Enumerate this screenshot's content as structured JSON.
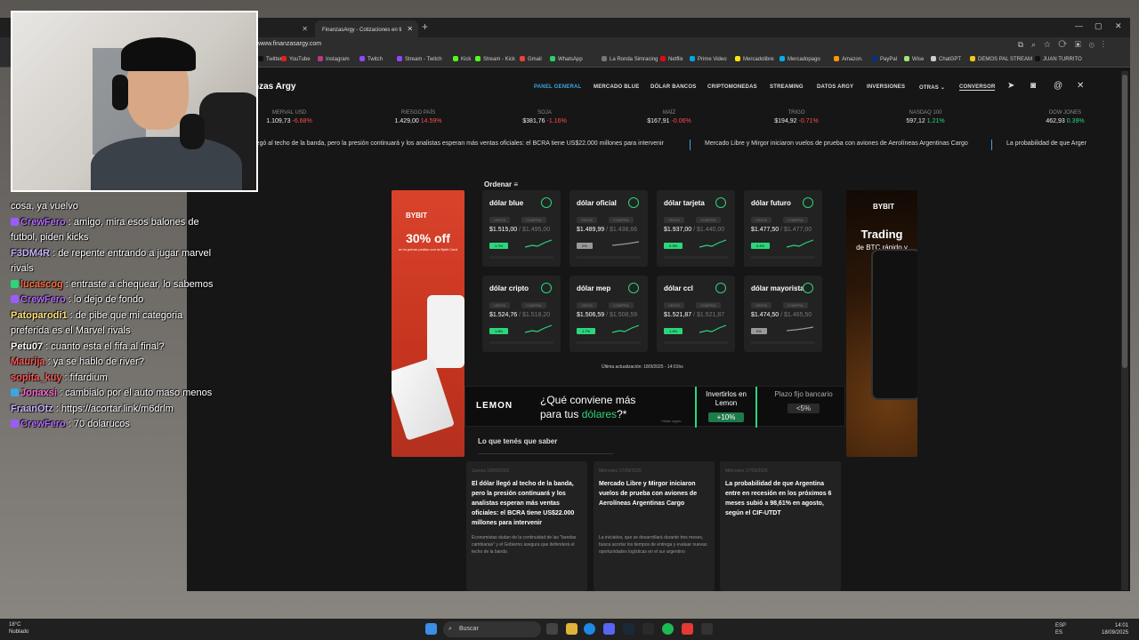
{
  "browser": {
    "tabs": [
      {
        "label": "FinanzasArgy - Cotizaciones en ti"
      }
    ],
    "url": "www.finanzasargy.com",
    "bookmarks": [
      {
        "label": "Twitter",
        "color": "#111"
      },
      {
        "label": "YouTube",
        "color": "#e62117"
      },
      {
        "label": "Instagram",
        "color": "#c13584"
      },
      {
        "label": "Twitch",
        "color": "#9146ff"
      },
      {
        "label": "Stream - Twitch",
        "color": "#9146ff"
      },
      {
        "label": "Kick",
        "color": "#53fc18"
      },
      {
        "label": "Stream - Kick",
        "color": "#53fc18"
      },
      {
        "label": "Gmail",
        "color": "#ea4335"
      },
      {
        "label": "WhatsApp",
        "color": "#25d366"
      },
      {
        "label": "La Ronda Simracing",
        "color": "#777"
      },
      {
        "label": "Netflix",
        "color": "#e50914"
      },
      {
        "label": "Prime Video",
        "color": "#00a8e1"
      },
      {
        "label": "Mercadolibre",
        "color": "#ffe600"
      },
      {
        "label": "Mercadopago",
        "color": "#00b1ea"
      },
      {
        "label": "Amazon.",
        "color": "#ff9900"
      },
      {
        "label": "PayPal",
        "color": "#003087"
      },
      {
        "label": "Wise",
        "color": "#9fe870"
      },
      {
        "label": "ChatGPT",
        "color": "#cccccc"
      },
      {
        "label": "DEMOS PAL STREAM",
        "color": "#f5c518"
      },
      {
        "label": "JUAN TURRITO",
        "color": "#111"
      }
    ]
  },
  "site": {
    "logo": "nzas Argy",
    "nav": [
      "PANEL GENERAL",
      "MERCADO BLUE",
      "DÓLAR BANCOS",
      "CRIPTOMONEDAS",
      "STREAMING",
      "DATOS ARGY",
      "INVERSIONES",
      "OTRAS",
      "CONVERSOR"
    ],
    "quotes": [
      {
        "name": "MERVAL USD",
        "value": "1.109,73",
        "change": "-6.68%",
        "dir": "neg"
      },
      {
        "name": "RIESGO PAÍS",
        "value": "1.429,00",
        "change": "14.59%",
        "dir": "neg"
      },
      {
        "name": "SOJA",
        "value": "$381,76",
        "change": "-1.16%",
        "dir": "neg"
      },
      {
        "name": "MAÍZ",
        "value": "$167,91",
        "change": "-0.06%",
        "dir": "neg"
      },
      {
        "name": "TRIGO",
        "value": "$194,92",
        "change": "-0.71%",
        "dir": "neg"
      },
      {
        "name": "NASDAQ 100",
        "value": "597,12",
        "change": "1.21%",
        "dir": "pos"
      },
      {
        "name": "DOW JONES",
        "value": "462,93",
        "change": "0.39%",
        "dir": "pos"
      }
    ],
    "ticker": [
      "legó al techo de la banda, pero la presión continuará y los analistas esperan más ventas oficiales: el BCRA tiene US$22.000 millones para intervenir",
      "Mercado Libre y Mirgor iniciaron vuelos de prueba con aviones de Aerolíneas Argentinas Cargo",
      "La probabilidad de que Arger"
    ],
    "ordenar": "Ordenar",
    "venta_label": "VENTA",
    "compra_label": "COMPRA",
    "cards": [
      {
        "title": "dólar blue",
        "venta": "$1.515,00",
        "compra": "$1.495,00",
        "pct": "1.7%",
        "trend": "up"
      },
      {
        "title": "dólar oficial",
        "venta": "$1.489,99",
        "compra": "$1.438,66",
        "pct": "0%",
        "trend": "flat"
      },
      {
        "title": "dólar tarjeta",
        "venta": "$1.937,00",
        "compra": "$1.440,00",
        "pct": "0.3%",
        "trend": "up"
      },
      {
        "title": "dólar futuro",
        "venta": "$1.477,50",
        "compra": "$1.477,00",
        "pct": "0.4%",
        "trend": "up"
      },
      {
        "title": "dólar cripto",
        "venta": "$1.524,76",
        "compra": "$1.518,20",
        "pct": "1.8%",
        "trend": "up"
      },
      {
        "title": "dólar mep",
        "venta": "$1.506,59",
        "compra": "$1.508,59",
        "pct": "1.7%",
        "trend": "up"
      },
      {
        "title": "dólar ccl",
        "venta": "$1.521,87",
        "compra": "$1.521,87",
        "pct": "1.4%",
        "trend": "up"
      },
      {
        "title": "dólar mayorista",
        "venta": "$1.474,50",
        "compra": "$1.465,50",
        "pct": "0%",
        "trend": "flat"
      }
    ],
    "update": "Última actualización: 18/9/2025 - 14:01hs",
    "ad_left": {
      "brand": "BYBIT",
      "offer": "30% off",
      "sub": "en tu primer pedido con la Bybit Card"
    },
    "ad_right": {
      "brand": "BYBIT",
      "headline": "Trading",
      "sub": "de BTC rápido y seguro"
    },
    "lemon": {
      "logo": "LEMON",
      "q1": "¿Qué conviene más",
      "q2a": "para tus",
      "q2b": "dólares",
      "q2c": "?*",
      "fine": "*dólar crypto",
      "box1_title": "Invertirlos en Lemon",
      "box1_value": "+10%",
      "box2_title": "Plazo fijo bancario",
      "box2_value": "<5%"
    },
    "section_title": "Lo que tenés que saber",
    "news": [
      {
        "date": "Jueves 18/09/2025",
        "headline": "El dólar llegó al techo de la banda, pero la presión continuará y los analistas esperan más ventas oficiales: el BCRA tiene US$22.000 millones para intervenir",
        "body": "Economistas dudan de la continuidad de las \"bandas cambiarias\" y el Gobierno asegura que defenderá el techo de la banda"
      },
      {
        "date": "Miércoles 17/09/2025",
        "headline": "Mercado Libre y Mirgor iniciaron vuelos de prueba con aviones de Aerolíneas Argentinas Cargo",
        "body": "La iniciativa, que se desarrollará durante tres meses, busca acortar los tiempos de entrega y evaluar nuevas oportunidades logísticas en el sur argentino"
      },
      {
        "date": "Miércoles 17/09/2025",
        "headline": "La probabilidad de que Argentina entre en recesión en los próximos 6 meses subió a 98,61% en agosto, según el CIF-UTDT",
        "body": ""
      }
    ]
  },
  "chat": [
    {
      "user": "",
      "msg": "cosa, ya vuelvo",
      "color": "#ffffff",
      "badge": ""
    },
    {
      "user": "CrewFero",
      "msg": ": amigo, mira esos balones de futbol, piden kicks",
      "color": "#b46cff",
      "badge": "#9a5cff"
    },
    {
      "user": "F3DM4R",
      "msg": ": de repente entrando a jugar marvel rivals",
      "color": "#c9b6ff",
      "badge": ""
    },
    {
      "user": "lucascog",
      "msg": ": entraste a chequear, lo sabemos",
      "color": "#ff6a3d",
      "badge": "#2bd67b"
    },
    {
      "user": "CrewFero",
      "msg": ": lo dejo de fondo",
      "color": "#b46cff",
      "badge": "#9a5cff"
    },
    {
      "user": "Patoparodi1",
      "msg": ": de pibe que mi categoria preferida es el Marvel rivals",
      "color": "#ffe27a",
      "badge": ""
    },
    {
      "user": "Petu07",
      "msg": ": cuanto esta el fifa al final?",
      "color": "#ffffff",
      "badge": ""
    },
    {
      "user": "Maurija",
      "msg": ": ya se hablo de river?",
      "color": "#ff5a5a",
      "badge": ""
    },
    {
      "user": "sopita_kuy",
      "msg": ": fifardium",
      "color": "#ff5a5a",
      "badge": ""
    },
    {
      "user": "Jonaxsi",
      "msg": ": cambialo por el auto maso menos",
      "color": "#ff6ad5",
      "badge": "#3aa7e0"
    },
    {
      "user": "FraanOtz",
      "msg": ": https://acortar.link/m6drlm",
      "color": "#c9b6ff",
      "badge": ""
    },
    {
      "user": "CrewFero",
      "msg": ": 70 dolarucos",
      "color": "#b46cff",
      "badge": "#9a5cff"
    }
  ],
  "taskbar": {
    "weather_temp": "18°C",
    "weather_desc": "Nublado",
    "search": "Buscar",
    "lang1": "ESP",
    "lang2": "ES",
    "time": "14:01",
    "date": "18/09/2025"
  }
}
